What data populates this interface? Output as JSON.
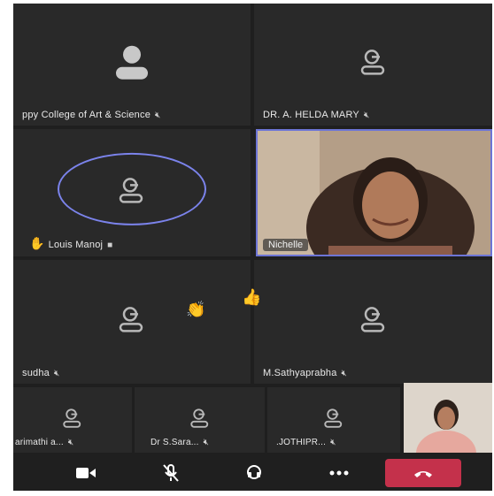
{
  "participants": [
    {
      "name": "ppy College of  Art & Science",
      "status_icon": "mic-muted-icon"
    },
    {
      "name": "DR. A. HELDA MARY",
      "status_icon": "mic-muted-icon"
    },
    {
      "name": "Louis Manoj",
      "status_icon": "camera-off-icon",
      "reaction": "raised-hand"
    },
    {
      "name": "Nichelle",
      "video": true
    },
    {
      "name": "sudha",
      "status_icon": "mic-muted-icon"
    },
    {
      "name": "M.Sathyaprabha",
      "status_icon": "mic-muted-icon"
    },
    {
      "name": "arimathi a...",
      "status_icon": "mic-muted-icon"
    },
    {
      "name": "Dr S.Sara...",
      "status_icon": "mic-muted-icon"
    },
    {
      "name": ".JOTHIPR...",
      "status_icon": "mic-muted-icon"
    }
  ],
  "reactions": [
    "clapping-hands",
    "thumbs-up"
  ],
  "toolbar": {
    "buttons": [
      "camera-icon",
      "mic-off-icon",
      "speaker-icon",
      "more-icon",
      "hang-up-icon"
    ]
  },
  "colors": {
    "background": "#1f1f1f",
    "tile": "#292929",
    "accent": "#7b83eb",
    "hangup": "#c4314b"
  }
}
